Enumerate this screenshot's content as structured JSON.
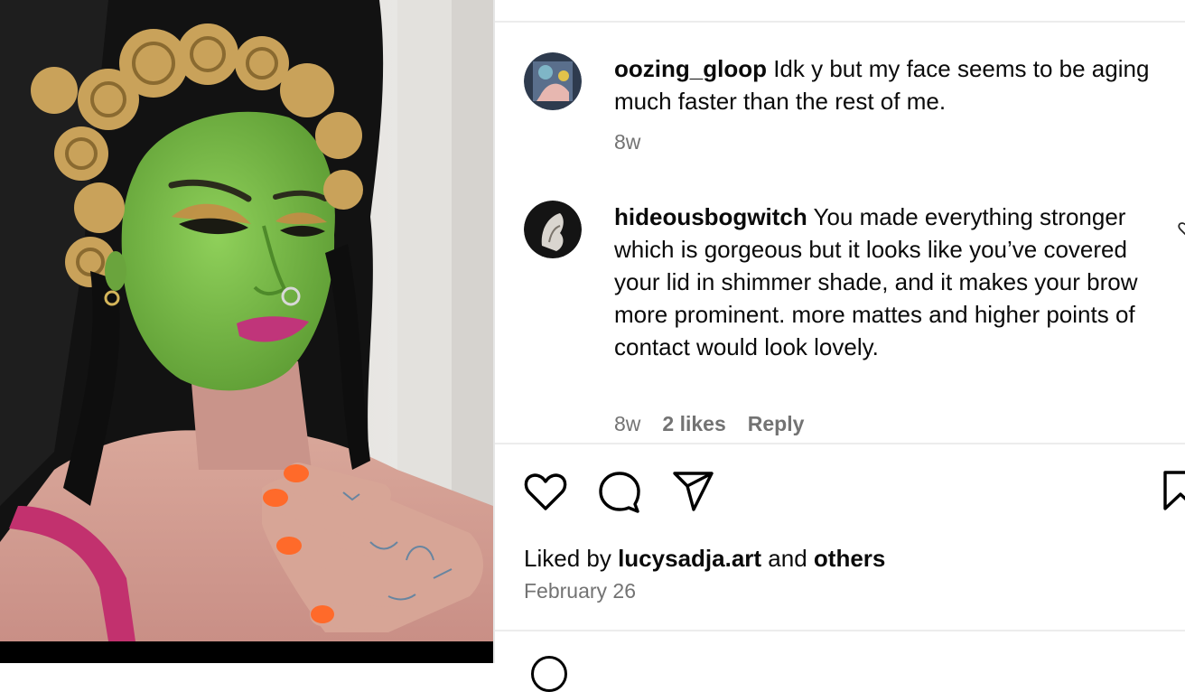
{
  "post": {
    "image_alt": "selfie with green face makeup",
    "liked_by_prefix": "Liked by",
    "liked_by_user": "lucysadja.art",
    "liked_by_and": "and",
    "liked_by_others": "others",
    "date": "February 26"
  },
  "comments": [
    {
      "username": "oozing_gloop",
      "text": " Idk y but my face seems to be aging much faster than the rest of me.",
      "age": "8w",
      "avatar_icon": "user-avatar"
    },
    {
      "username": "hideousbogwitch",
      "text": " You made everything stronger which is gorgeous but it looks like you’ve covered your lid in shimmer shade, and it makes your brow more prominent. more mattes and higher points of contact would look lovely.",
      "age": "8w",
      "likes": "2 likes",
      "reply_label": "Reply",
      "avatar_icon": "user-avatar"
    }
  ],
  "actions": {
    "like_icon": "heart-icon",
    "comment_icon": "comment-icon",
    "share_icon": "send-icon",
    "save_icon": "bookmark-icon"
  },
  "colors": {
    "secondary_text": "#737373",
    "divider": "#ececec",
    "face_green": "#7fc24a",
    "lipstick": "#c0357a",
    "nail_orange": "#ff6a2a"
  }
}
